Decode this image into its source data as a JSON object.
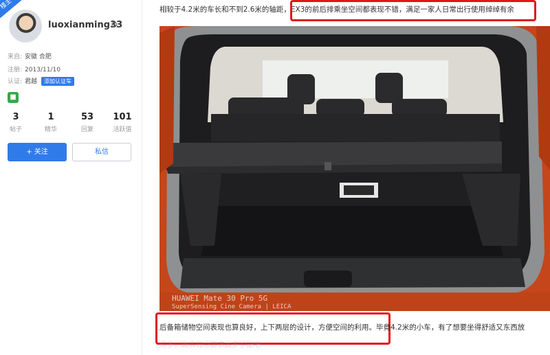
{
  "corner_tag": "楼主",
  "profile": {
    "username": "luoxianming33",
    "location_label": "来自:",
    "location": "安徽 合肥",
    "register_label": "注册:",
    "register_date": "2013/11/10",
    "cert_label": "认证:",
    "cert_value": "君越",
    "cert_tag": "添加认证车"
  },
  "stats": [
    {
      "value": "3",
      "label": "帖子"
    },
    {
      "value": "1",
      "label": "精华"
    },
    {
      "value": "53",
      "label": "回复"
    },
    {
      "value": "101",
      "label": "活跃值"
    }
  ],
  "buttons": {
    "follow": "+ 关注",
    "message": "私信"
  },
  "post": {
    "top_text": "相较于4.2米的车长和不到2.6米的轴距，EX3的前后排乘坐空间都表现不错，满足一家人日常出行使用绰绰有余",
    "photo_watermark_line1": "HUAWEI Mate 30 Pro 5G",
    "photo_watermark_line2": "SuperSensing Cine Camera | LEICA",
    "bottom_text": "后备箱储物空间表现也算良好，上下两层的设计，方便空间的利用。毕竟4.2米的小车，有了想要坐得舒适又东西放",
    "bottom_text_2": "得多，确实有点要求太多了是吧"
  },
  "colors": {
    "accent": "#2f7bea",
    "highlight_box": "#e0161b",
    "car_body": "#c9481a"
  }
}
